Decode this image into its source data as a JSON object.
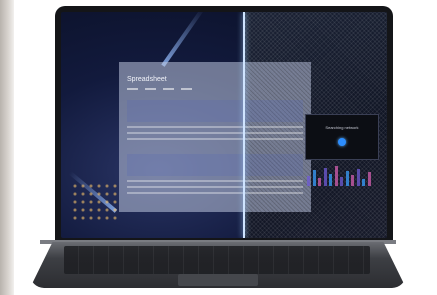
{
  "photo": {
    "subject": "laptop",
    "accent_color": "#2c8dff",
    "divider_color": "#cfe4ff"
  },
  "screen": {
    "spreadsheet_title": "Spreadsheet",
    "popup_text": "Searching network",
    "chart_bar_colors": [
      "#6f5bd6",
      "#3aa0ff",
      "#d45fb0"
    ]
  }
}
